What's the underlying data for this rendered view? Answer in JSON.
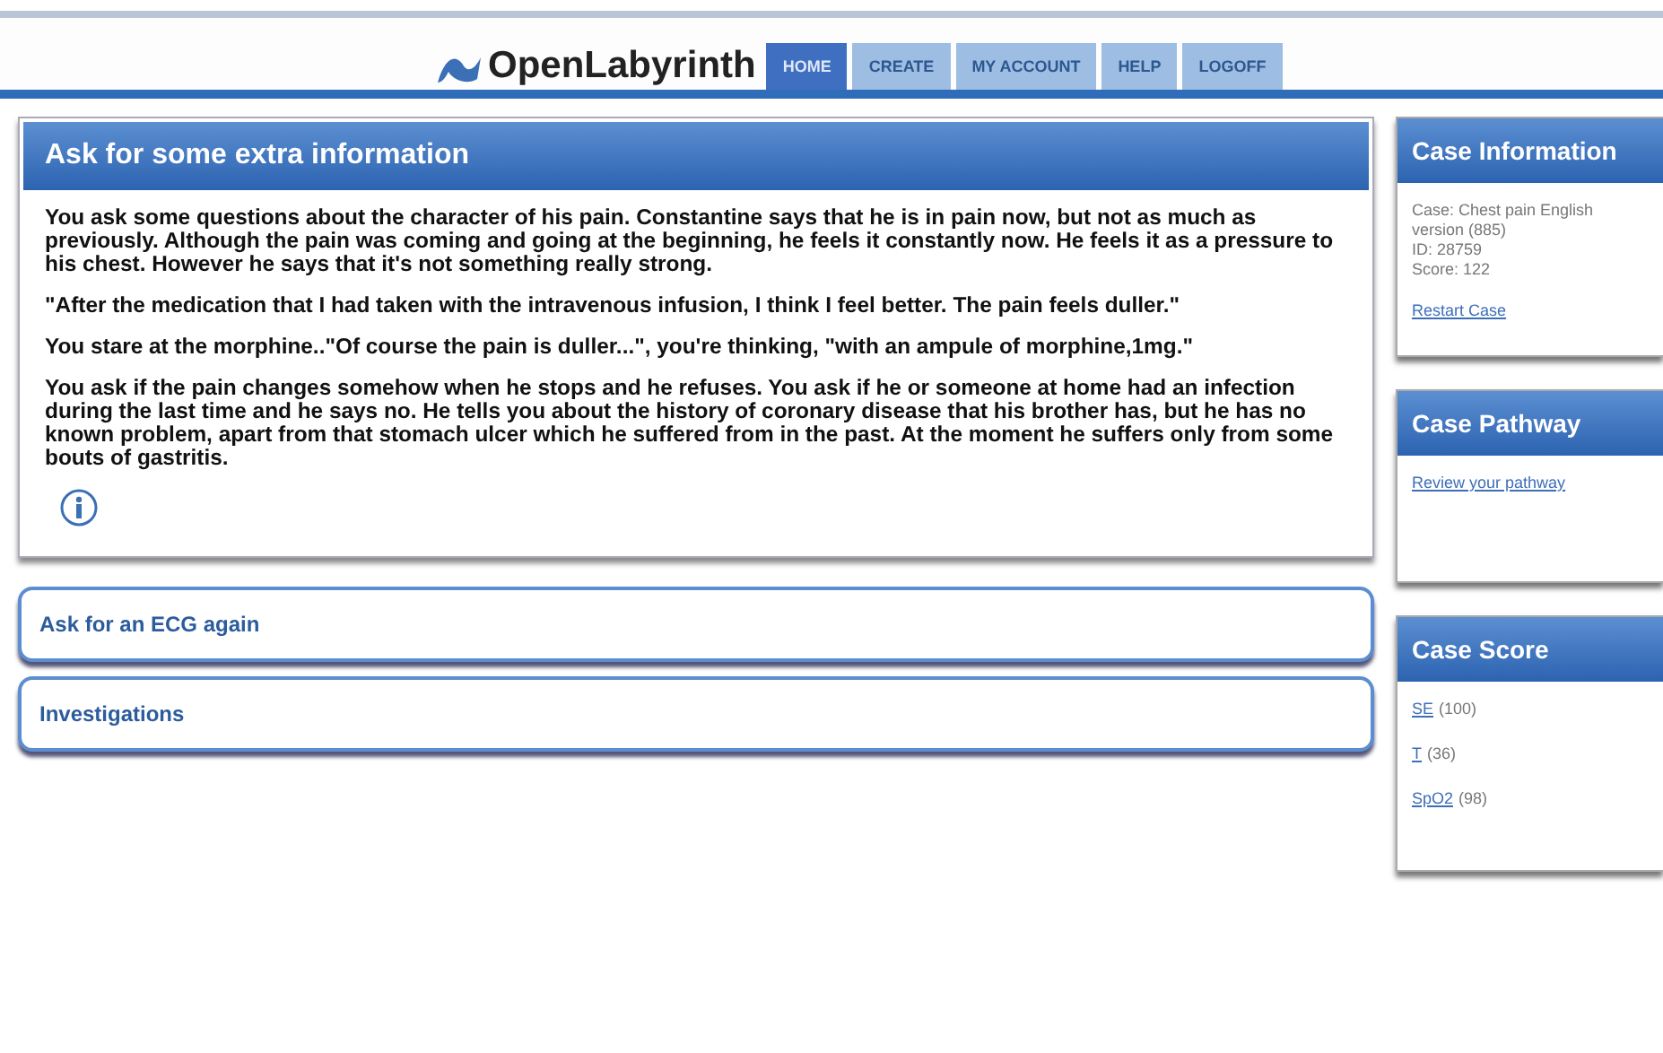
{
  "header": {
    "logo": "OpenLabyrinth",
    "nav": [
      {
        "label": "HOME",
        "selected": true
      },
      {
        "label": "CREATE",
        "selected": false
      },
      {
        "label": "MY ACCOUNT",
        "selected": false
      },
      {
        "label": "HELP",
        "selected": false
      },
      {
        "label": "LOGOFF",
        "selected": false
      }
    ]
  },
  "node": {
    "title": "Ask for some extra information",
    "paragraphs": [
      "You ask some questions about the character of his pain. Constantine says that he is in pain now, but not as much as previously. Although the pain was coming and going at the beginning, he feels it constantly now. He feels it as a pressure to his chest. However he says that it's not something really strong.",
      "\"After the medication that I had taken with the intravenous infusion, I think I feel better. The pain feels duller.\"",
      "You stare at the morphine..\"Of course the pain is duller...\", you're thinking, \"with an ampule of morphine,1mg.\"",
      "You ask if the pain changes somehow when he stops and he refuses. You ask if he or someone at home had an infection during the last time and he says no. He tells you about the history of coronary disease that his brother has, but he has no known problem, apart from that stomach ulcer which he suffered from in the past. At the moment he suffers only from some bouts of gastritis."
    ]
  },
  "options": [
    "Ask for an ECG again",
    "Investigations"
  ],
  "sidebar": {
    "case_information": {
      "title": "Case Information",
      "lines": [
        "Case: Chest pain English",
        "version (885)",
        "ID: 28759",
        "Score: 122"
      ],
      "link": "Restart Case"
    },
    "case_pathway": {
      "title": "Case Pathway",
      "link": "Review your pathway"
    },
    "case_score": {
      "title": "Case Score",
      "items": [
        {
          "link": "SE",
          "value": "(100)"
        },
        {
          "link": "T",
          "value": "(36)"
        },
        {
          "link": "SpO2",
          "value": "(98)"
        }
      ]
    }
  }
}
